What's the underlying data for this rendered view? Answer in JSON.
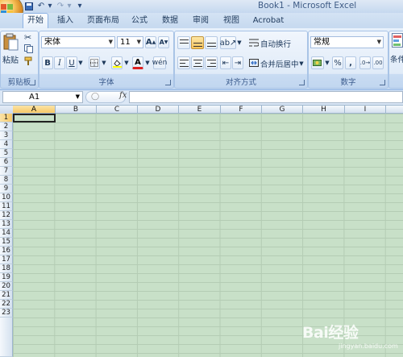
{
  "window": {
    "title": "Book1 - Microsoft Excel"
  },
  "tabs": [
    "开始",
    "插入",
    "页面布局",
    "公式",
    "数据",
    "审阅",
    "视图",
    "Acrobat"
  ],
  "ribbon": {
    "clipboard": {
      "paste_label": "粘贴",
      "group_label": "剪贴板"
    },
    "font": {
      "font_name": "宋体",
      "font_size": "11",
      "bold": "B",
      "italic": "I",
      "underline": "U",
      "font_color_glyph": "A",
      "group_label": "字体"
    },
    "alignment": {
      "wrap_text": "自动换行",
      "merge_center": "合并后居中",
      "group_label": "对齐方式"
    },
    "number": {
      "format": "常规",
      "percent": "%",
      "comma": ",",
      "group_label": "数字"
    },
    "styles": {
      "partial_label": "条件"
    }
  },
  "formula_bar": {
    "cell_ref": "A1",
    "fx": "fx",
    "formula": ""
  },
  "columns": [
    "A",
    "B",
    "C",
    "D",
    "E",
    "F",
    "G",
    "H",
    "I"
  ],
  "rows": [
    "1",
    "2",
    "3",
    "4",
    "5",
    "6",
    "7",
    "8",
    "9",
    "10",
    "11",
    "12",
    "13",
    "14",
    "15",
    "16",
    "17",
    "18",
    "19",
    "20",
    "21",
    "22",
    "23"
  ],
  "selected_cell": "A1",
  "watermark": {
    "text": "Bai经验",
    "sub": "jingyan.baidu.com"
  },
  "colors": {
    "sheet_background": "#c8e0c8",
    "gridline": "#b4ccb4",
    "ribbon_accent": "#8db2e3"
  }
}
